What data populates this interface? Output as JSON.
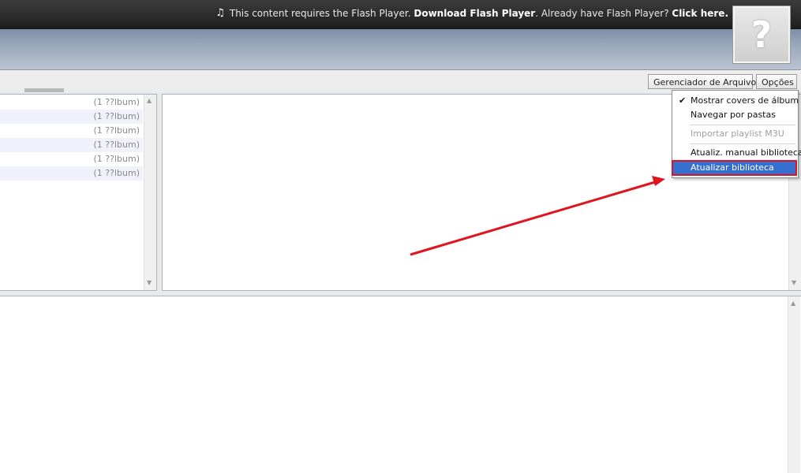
{
  "flash_bar": {
    "prefix": "This content requires the Flash Player.",
    "download_link": "Download Flash Player",
    "middle": "Already have Flash Player?",
    "click_link": "Click here",
    "help_glyph": "?"
  },
  "toolbar": {
    "file_manager_label": "Gerenciador de Arquivos",
    "options_label": "Opções"
  },
  "left_list": {
    "rows": [
      "(1 ??lbum)",
      "(1 ??lbum)",
      "(1 ??lbum)",
      "(1 ??lbum)",
      "(1 ??lbum)",
      "(1 ??lbum)"
    ]
  },
  "options_menu": {
    "items": [
      {
        "label": "Mostrar covers de álbum",
        "checked": true,
        "enabled": true
      },
      {
        "label": "Navegar por pastas",
        "checked": false,
        "enabled": true
      },
      {
        "label": "Importar playlist M3U",
        "checked": false,
        "enabled": false
      },
      {
        "label": "Atualiz. manual biblioteca",
        "checked": false,
        "enabled": true
      },
      {
        "label": "Atualizar biblioteca",
        "checked": false,
        "enabled": true,
        "highlighted": true
      }
    ]
  },
  "colors": {
    "highlight": "#3670cf",
    "annotation_red": "#e0141e"
  }
}
